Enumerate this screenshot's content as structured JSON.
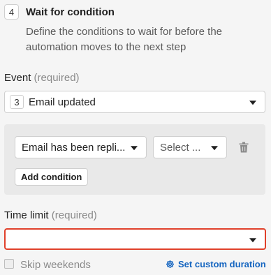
{
  "step": {
    "number": "4",
    "title": "Wait for condition",
    "description": "Define the conditions to wait for before the automation moves to the next step"
  },
  "event": {
    "label": "Event",
    "required_text": "(required)",
    "number": "3",
    "value": "Email updated"
  },
  "conditions": {
    "condition_value": "Email has been repli...",
    "operator_placeholder": "Select ...",
    "add_button_label": "Add condition"
  },
  "time_limit": {
    "label": "Time limit",
    "required_text": "(required)",
    "value": ""
  },
  "options": {
    "skip_weekends_label": "Skip weekends",
    "skip_weekends_checked": false,
    "custom_duration_label": "Set custom duration"
  },
  "colors": {
    "error_border": "#e0402a",
    "link": "#1565c0",
    "panel": "#e9e9e9",
    "background": "#f5f5f5"
  },
  "icons": {
    "dropdown": "caret-down-icon",
    "delete": "trash-icon",
    "settings": "gear-icon"
  }
}
